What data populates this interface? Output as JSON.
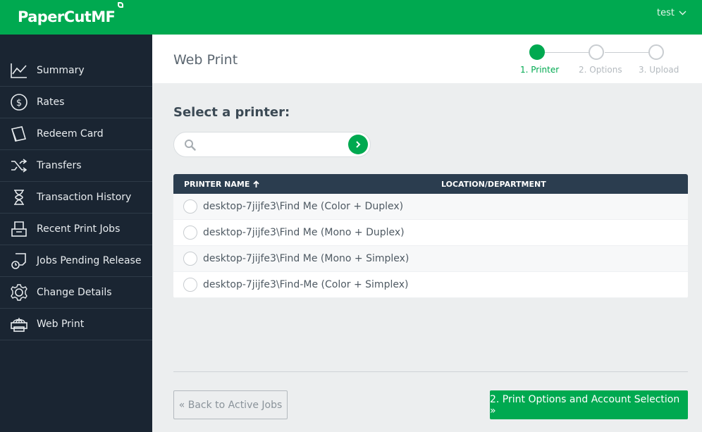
{
  "app": {
    "logo_text": "PaperCutMF",
    "user": "test"
  },
  "sidebar": {
    "items": [
      {
        "label": "Summary",
        "icon": "chart-icon"
      },
      {
        "label": "Rates",
        "icon": "dollar-icon"
      },
      {
        "label": "Redeem Card",
        "icon": "card-icon"
      },
      {
        "label": "Transfers",
        "icon": "shuffle-icon"
      },
      {
        "label": "Transaction History",
        "icon": "hourglass-icon"
      },
      {
        "label": "Recent Print Jobs",
        "icon": "tray-icon"
      },
      {
        "label": "Jobs Pending Release",
        "icon": "document-clock-icon"
      },
      {
        "label": "Change Details",
        "icon": "gear-icon"
      },
      {
        "label": "Web Print",
        "icon": "printer-globe-icon"
      }
    ]
  },
  "header": {
    "title": "Web Print",
    "steps": [
      {
        "label": "1. Printer",
        "active": true
      },
      {
        "label": "2. Options",
        "active": false
      },
      {
        "label": "3. Upload",
        "active": false
      }
    ]
  },
  "main": {
    "select_title": "Select a printer:",
    "search": {
      "placeholder": "",
      "value": ""
    },
    "table": {
      "columns": [
        "PRINTER NAME",
        "LOCATION/DEPARTMENT"
      ],
      "sort_indicator": "up-arrow-icon",
      "rows": [
        {
          "name": "desktop-7jijfe3\\Find Me (Color + Duplex)",
          "location": ""
        },
        {
          "name": "desktop-7jijfe3\\Find Me (Mono + Duplex)",
          "location": ""
        },
        {
          "name": "desktop-7jijfe3\\Find Me (Mono + Simplex)",
          "location": ""
        },
        {
          "name": "desktop-7jijfe3\\Find-Me (Color + Simplex)",
          "location": ""
        }
      ]
    },
    "back_button": "« Back to Active Jobs",
    "next_button": "2. Print Options and Account Selection »"
  },
  "colors": {
    "brand": "#00a950",
    "sidebar": "#1a2532",
    "table_header": "#2b3d4f"
  }
}
